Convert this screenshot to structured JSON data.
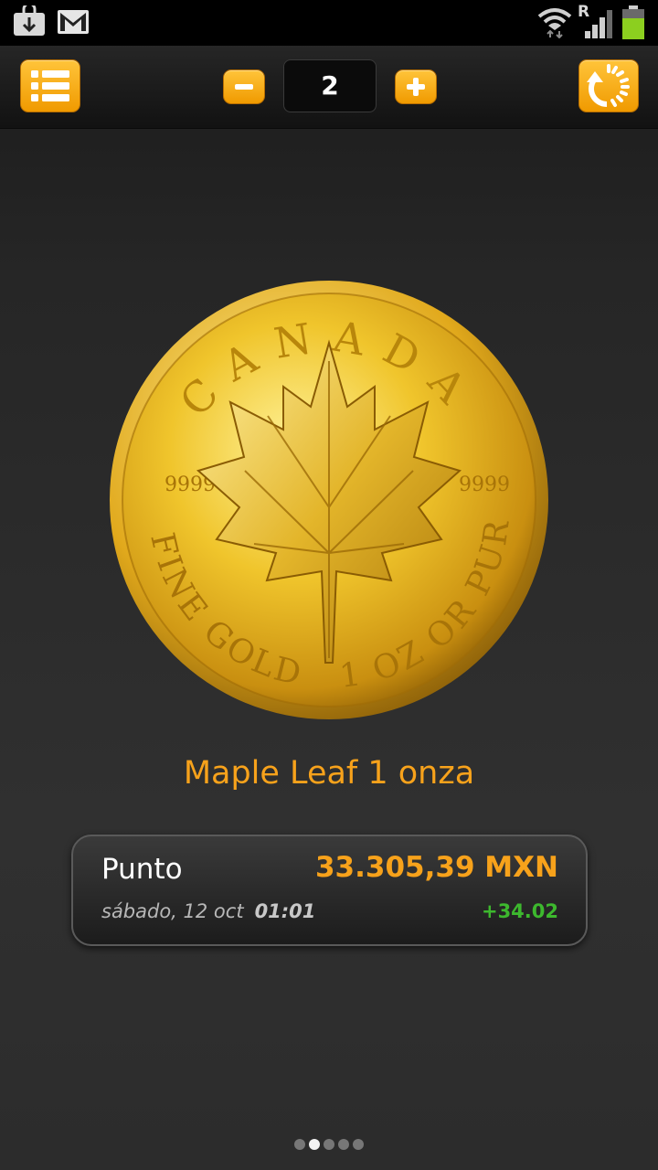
{
  "status_bar": {
    "icons": [
      "download-icon",
      "gmail-icon",
      "wifi-icon",
      "roaming-indicator",
      "signal-icon",
      "battery-icon"
    ],
    "roaming_label": "R"
  },
  "toolbar": {
    "menu_icon": "list-menu-icon",
    "decrement_label": "−",
    "counter_value": "2",
    "increment_label": "+",
    "refresh_icon": "refresh-icon",
    "accent_color": "#f7a21b"
  },
  "coin": {
    "icon": "maple-leaf-gold-coin",
    "top_inscription": "CANADA",
    "left_purity": "9999",
    "right_purity": "9999",
    "bottom_left": "FINE GOLD",
    "bottom_right": "1 OZ OR PUR"
  },
  "product": {
    "title": "Maple Leaf 1 onza"
  },
  "price": {
    "label": "Punto",
    "value": "33.305,39 MXN",
    "date": "sábado, 12 oct",
    "time": "01:01",
    "change": "+34.02",
    "price_color": "#f7a21b",
    "change_color": "#3db82e"
  },
  "pager": {
    "total": 5,
    "active_index": 1
  }
}
